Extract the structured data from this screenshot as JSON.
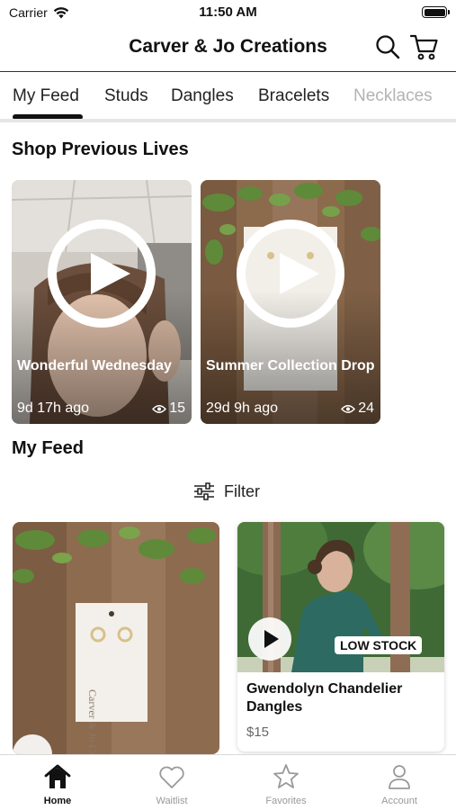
{
  "status_bar": {
    "carrier": "Carrier",
    "time": "11:50 AM"
  },
  "header": {
    "title": "Carver & Jo Creations",
    "search_icon": "search-icon",
    "cart_icon": "cart-icon"
  },
  "tabs": [
    {
      "label": "My Feed",
      "active": true
    },
    {
      "label": "Studs"
    },
    {
      "label": "Dangles"
    },
    {
      "label": "Bracelets"
    },
    {
      "label": "Necklaces"
    }
  ],
  "previous_lives": {
    "title": "Shop Previous Lives",
    "items": [
      {
        "title": "Wonderful Wednesday",
        "age": "9d 17h ago",
        "views": "15"
      },
      {
        "title": "Summer Collection Drop",
        "age": "29d 9h ago",
        "views": "24"
      }
    ]
  },
  "feed": {
    "title": "My Feed",
    "filter_label": "Filter",
    "items": [
      {
        "card_text": "Carver & Jo Creations"
      },
      {
        "badge": "LOW STOCK",
        "name": "Gwendolyn Chandelier Dangles",
        "price": "$15"
      }
    ]
  },
  "bottom_nav": [
    {
      "label": "Home",
      "icon": "home-icon",
      "active": true
    },
    {
      "label": "Waitlist",
      "icon": "heart-icon"
    },
    {
      "label": "Favorites",
      "icon": "star-icon"
    },
    {
      "label": "Account",
      "icon": "person-icon"
    }
  ],
  "colors": {
    "text": "#111111",
    "muted": "#999999",
    "divider": "#e6e6e6"
  }
}
